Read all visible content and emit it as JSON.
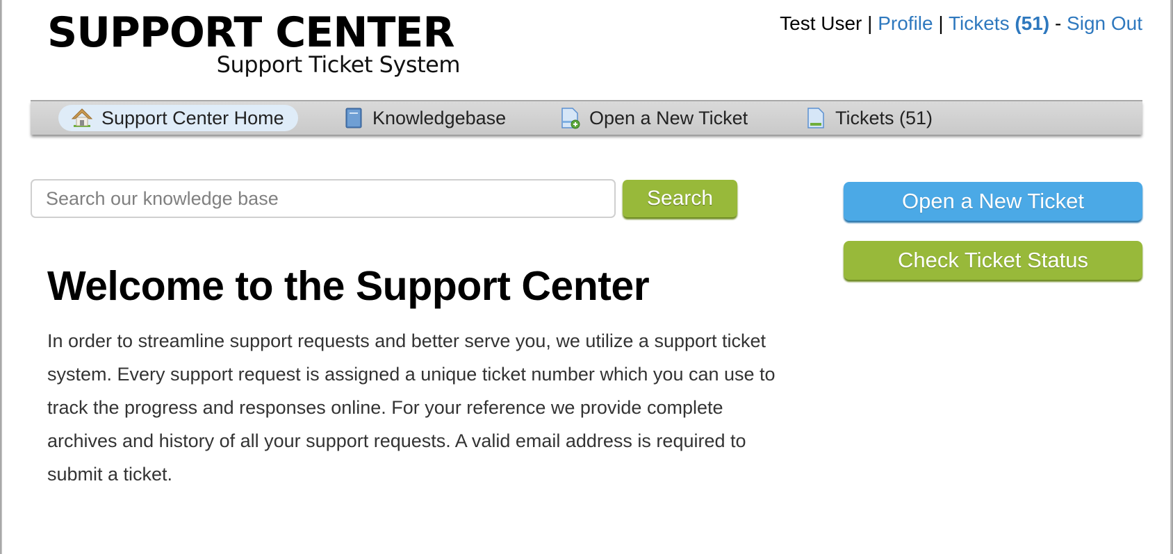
{
  "header": {
    "logo_title": "SUPPORT CENTER",
    "logo_subtitle": "Support Ticket System"
  },
  "userbar": {
    "user_name": "Test User",
    "separator": "|",
    "profile_label": "Profile",
    "tickets_label": "Tickets",
    "tickets_count": "(51)",
    "dash": "-",
    "sign_out_label": "Sign Out"
  },
  "nav": {
    "items": [
      {
        "label": "Support Center Home",
        "icon": "home-icon",
        "active": true
      },
      {
        "label": "Knowledgebase",
        "icon": "book-icon",
        "active": false
      },
      {
        "label": "Open a New Ticket",
        "icon": "new-ticket-icon",
        "active": false
      },
      {
        "label": "Tickets (51)",
        "icon": "ticket-document-icon",
        "active": false
      }
    ]
  },
  "search": {
    "placeholder": "Search our knowledge base",
    "value": "",
    "button_label": "Search"
  },
  "sidebar": {
    "open_ticket_label": "Open a New Ticket",
    "check_status_label": "Check Ticket Status"
  },
  "main": {
    "title": "Welcome to the Support Center",
    "body": "In order to streamline support requests and better serve you, we utilize a support ticket system. Every support request is assigned a unique ticket number which you can use to track the progress and responses online. For your reference we provide complete archives and history of all your support requests. A valid email address is required to submit a ticket."
  },
  "colors": {
    "link": "#2e78be",
    "primary_blue": "#4ba9e6",
    "primary_green": "#98b93a",
    "nav_active_bg": "#dfecf8"
  }
}
